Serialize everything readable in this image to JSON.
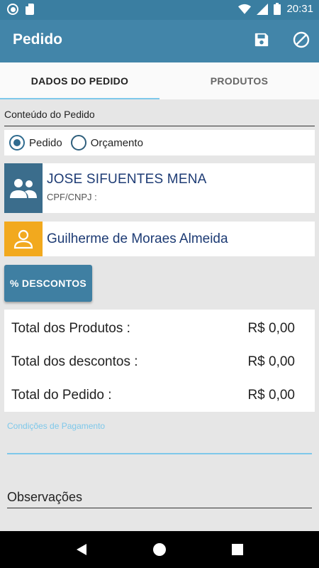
{
  "status_bar": {
    "time": "20:31"
  },
  "app_bar": {
    "title": "Pedido",
    "save_icon": "save-icon",
    "cancel_icon": "block-icon"
  },
  "tabs": [
    {
      "label": "DADOS DO PEDIDO",
      "active": true
    },
    {
      "label": "PRODUTOS",
      "active": false
    }
  ],
  "content": {
    "section_label": "Conteúdo do Pedido",
    "radio_options": [
      {
        "label": "Pedido",
        "checked": true
      },
      {
        "label": "Orçamento",
        "checked": false
      }
    ],
    "client": {
      "name": "JOSE SIFUENTES MENA",
      "doc_label": "CPF/CNPJ :"
    },
    "seller": {
      "name": "Guilherme de Moraes Almeida"
    },
    "discount_button": "% DESCONTOS",
    "totals": [
      {
        "label": "Total dos Produtos :",
        "value": "R$ 0,00"
      },
      {
        "label": "Total dos descontos :",
        "value": "R$ 0,00"
      },
      {
        "label": "Total do Pedido :",
        "value": "R$ 0,00"
      }
    ],
    "payment_placeholder": "Condições de Pagamento",
    "observations_label": "Observações"
  },
  "colors": {
    "primary": "#4285a9",
    "status_bar": "#3a7ea1",
    "accent": "#7ec8ea",
    "client_avatar_bg": "#3b6d8c",
    "seller_avatar_bg": "#f2a91e",
    "text_blue": "#1d3b74"
  }
}
